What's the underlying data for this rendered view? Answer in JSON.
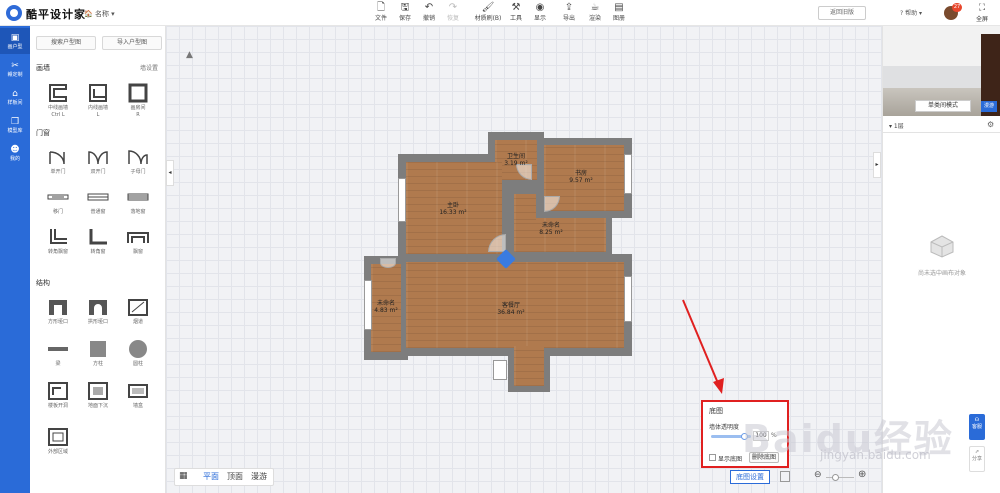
{
  "app": {
    "title": "酷平设计家",
    "doc_name": "名称"
  },
  "toolbar": {
    "items": [
      {
        "label": "文件",
        "icon": "file-icon"
      },
      {
        "label": "保存",
        "icon": "save-icon"
      },
      {
        "label": "撤销",
        "icon": "undo-icon"
      },
      {
        "label": "恢复",
        "icon": "redo-icon"
      },
      {
        "label": "材质刷(B)",
        "icon": "brush-icon"
      },
      {
        "label": "工具",
        "icon": "tools-icon"
      },
      {
        "label": "显示",
        "icon": "eye-icon"
      },
      {
        "label": "导出",
        "icon": "export-icon"
      },
      {
        "label": "渲染",
        "icon": "render-icon"
      },
      {
        "label": "图册",
        "icon": "album-icon"
      }
    ],
    "old_version": "返回旧版",
    "help": "帮助",
    "notification_count": "27",
    "fullscreen": "全屏"
  },
  "nav": {
    "items": [
      {
        "label": "画户型",
        "icon": "floorplan-icon"
      },
      {
        "label": "赣定制",
        "icon": "custom-icon"
      },
      {
        "label": "样板间",
        "icon": "home-icon"
      },
      {
        "label": "模型库",
        "icon": "model-icon"
      },
      {
        "label": "我的",
        "icon": "user-icon"
      }
    ]
  },
  "library": {
    "search_floorplan": "搜索户型图",
    "import_floorplan": "导入户型图",
    "walls": {
      "title": "画墙",
      "more": "墙设置",
      "items": [
        {
          "label": "中线画墙",
          "shortcut": "Ctrl L"
        },
        {
          "label": "内线画墙",
          "shortcut": "L"
        },
        {
          "label": "画房间",
          "shortcut": "R"
        }
      ]
    },
    "doors": {
      "title": "门窗",
      "items": [
        {
          "label": "单开门"
        },
        {
          "label": "双开门"
        },
        {
          "label": "子母门"
        },
        {
          "label": "移门"
        },
        {
          "label": "普通窗"
        },
        {
          "label": "落地窗"
        },
        {
          "label": "转角飘窗"
        },
        {
          "label": "转角窗"
        },
        {
          "label": "飘窗"
        }
      ]
    },
    "structure": {
      "title": "结构",
      "items": [
        {
          "label": "方形垭口"
        },
        {
          "label": "拱形垭口"
        },
        {
          "label": "烟道"
        },
        {
          "label": "梁"
        },
        {
          "label": "方柱"
        },
        {
          "label": "圆柱"
        },
        {
          "label": "楼板开洞"
        },
        {
          "label": "地面下沉"
        },
        {
          "label": "墙盒"
        },
        {
          "label": "外部区域"
        }
      ]
    }
  },
  "plan": {
    "rooms": [
      {
        "name": "卫生间",
        "area": "3.19 m²"
      },
      {
        "name": "书房",
        "area": "9.57 m²"
      },
      {
        "name": "主卧",
        "area": "16.33 m²"
      },
      {
        "name": "未命名",
        "area": "8.25 m²"
      },
      {
        "name": "未命名",
        "area": "4.83 m²"
      },
      {
        "name": "客餐厅",
        "area": "36.84 m²"
      }
    ]
  },
  "view_tabs": [
    "平面",
    "顶面",
    "漫游"
  ],
  "floor_panel": {
    "title": "底图",
    "opacity_label": "墙体透明度",
    "opacity_value": "100",
    "opacity_unit": "%",
    "opacity_level": 1.0,
    "show_label": "显示底图",
    "show_checked": false,
    "delete_label": "删除底图"
  },
  "bottom": {
    "floor_settings": "底图设置"
  },
  "right_panel": {
    "roam_mode": "单类间模式",
    "side_btn": "漫游",
    "floor": "1层",
    "empty_text": "尚未选中画布对象",
    "service": "客服",
    "share": "分享"
  },
  "watermark": {
    "main": "Baidu经验",
    "sub": "jingyan.baidu.com"
  },
  "colors": {
    "accent": "#2a6bd8",
    "highlight": "#e02020",
    "wood": "#b07a4e"
  }
}
